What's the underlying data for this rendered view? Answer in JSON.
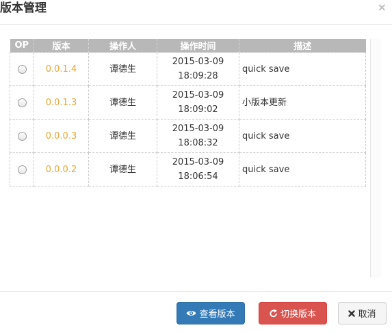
{
  "dialog": {
    "title": "版本管理",
    "close_glyph": "×"
  },
  "table": {
    "headers": [
      "OP",
      "版本",
      "操作人",
      "操作时间",
      "描述"
    ],
    "rows": [
      {
        "version": "0.0.1.4",
        "operator": "谭德生",
        "date": "2015-03-09",
        "time": "18:09:28",
        "description": "quick save"
      },
      {
        "version": "0.0.1.3",
        "operator": "谭德生",
        "date": "2015-03-09",
        "time": "18:09:02",
        "description": "小版本更新"
      },
      {
        "version": "0.0.0.3",
        "operator": "谭德生",
        "date": "2015-03-09",
        "time": "18:08:32",
        "description": "quick save"
      },
      {
        "version": "0.0.0.2",
        "operator": "谭德生",
        "date": "2015-03-09",
        "time": "18:06:54",
        "description": "quick save"
      }
    ]
  },
  "footer": {
    "view_label": "查看版本",
    "switch_label": "切换版本",
    "cancel_label": "取消"
  },
  "icons": {
    "view": "eye-icon",
    "switch": "refresh-icon",
    "cancel": "close-icon",
    "close": "close-icon"
  },
  "colors": {
    "primary": "#337ab7",
    "danger": "#d9534f",
    "version_text": "#e9a530",
    "header_bg": "#b8b8b8"
  }
}
